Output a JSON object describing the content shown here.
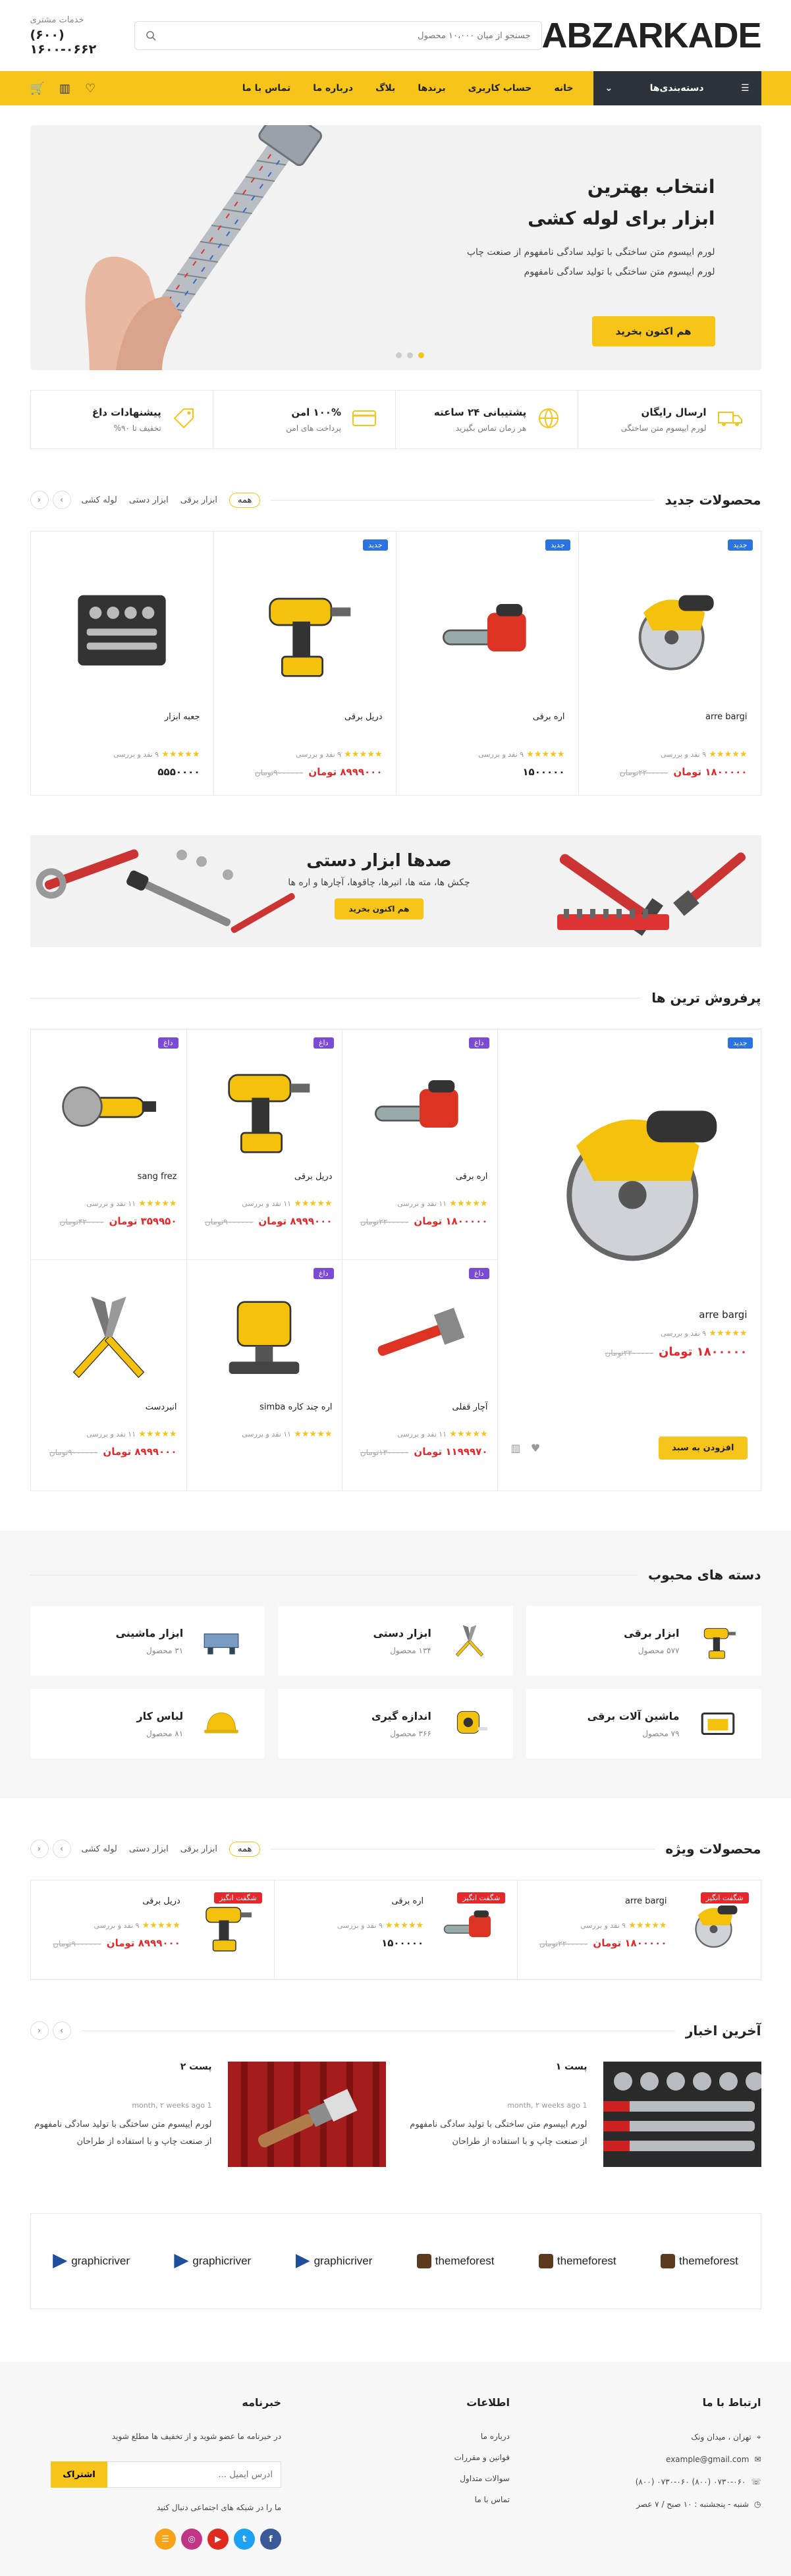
{
  "header": {
    "logo": "ABZARKADE",
    "search_placeholder": "جستجو از میان ۱۰،۰۰۰ محصول",
    "support_label": "خدمات مشتری",
    "support_phone": "(۶۰۰) ۱۶۰۰-۰۶۶۲"
  },
  "nav": {
    "categories_label": "دسته‌بندی‌ها",
    "items": [
      "خانه",
      "حساب کاربری",
      "برندها",
      "بلاگ",
      "درباره ما",
      "تماس با ما"
    ]
  },
  "hero": {
    "title_1": "انتخاب بهترین",
    "title_2": "ابزار برای لوله کشی",
    "line_1": "لورم ایپسوم متن ساختگی با تولید سادگی نامفهوم از صنعت چاپ",
    "line_2": "لورم ایپسوم متن ساختگی با تولید سادگی نامفهوم",
    "button": "هم اکنون بخرید"
  },
  "features": [
    {
      "title": "ارسال رایگان",
      "sub": "لورم ایپسوم متن ساختگی",
      "icon": "truck-icon"
    },
    {
      "title": "پشتیبانی ۲۴ ساعته",
      "sub": "هر زمان تماس بگیرید",
      "icon": "globe-icon"
    },
    {
      "title": "۱۰۰% امن",
      "sub": "پرداخت های امن",
      "icon": "card-icon"
    },
    {
      "title": "پیشنهادات داغ",
      "sub": "تخفیف تا ۹۰%",
      "icon": "tag-icon"
    }
  ],
  "new_products": {
    "title": "محصولات جدید",
    "tabs": [
      "همه",
      "ابزار برقی",
      "ابزار دستی",
      "لوله کشی"
    ],
    "items": [
      {
        "badge": "جدید",
        "name": "arre bargi",
        "rating": "۹ نقد و بررسی",
        "price": "۱۸۰۰۰۰۰ تومان",
        "old": "۲۲۰۰۰۰۰تومان",
        "img": "saw"
      },
      {
        "badge": "جدید",
        "name": "اره برقی",
        "rating": "۹ نقد و بررسی",
        "price": "۱۵۰۰۰۰۰",
        "old": "",
        "img": "chainsaw"
      },
      {
        "badge": "جدید",
        "name": "دریل برقی",
        "rating": "۹ نقد و بررسی",
        "price": "۸۹۹۹۰۰۰ تومان",
        "old": "۹۰۰۰۰۰۰تومان",
        "img": "drill"
      },
      {
        "badge": "",
        "name": "جعبه ابزار",
        "rating": "۹ نقد و بررسی",
        "price": "۵۵۵۰۰۰۰",
        "old": "",
        "img": "toolbox"
      }
    ]
  },
  "banner": {
    "title": "صدها ابزار دستی",
    "sub": "چکش ها، مته ها، انبرها، چاقوها، آچارها و اره ها",
    "button": "هم اکنون بخرید"
  },
  "best": {
    "title": "پرفروش ترین ها",
    "big": {
      "badge": "جدید",
      "name": "arre bargi",
      "rating": "۹ نقد و بررسی",
      "price": "۱۸۰۰۰۰۰ تومان",
      "old": "۲۲۰۰۰۰۰تومان",
      "button": "افزودن به سبد"
    },
    "items": [
      {
        "badge": "داغ",
        "name": "اره برقی",
        "rating": "۱۱ نقد و بررسی",
        "price": "۱۸۰۰۰۰۰ تومان",
        "old": "۲۲۰۰۰۰۰تومان",
        "img": "chainsaw"
      },
      {
        "badge": "داغ",
        "name": "دریل برقی",
        "rating": "۱۱ نقد و بررسی",
        "price": "۸۹۹۹۰۰۰ تومان",
        "old": "۹۰۰۰۰۰۰تومان",
        "img": "drill"
      },
      {
        "badge": "داغ",
        "name": "sang frez",
        "rating": "۱۱ نقد و بررسی",
        "price": "۳۵۹۹۵۰ تومان",
        "old": "۴۲۰۰۰۰تومان",
        "img": "grinder"
      },
      {
        "badge": "داغ",
        "name": "آچار قفلی",
        "rating": "۱۱ نقد و بررسی",
        "price": "۱۱۹۹۹۷۰ تومان",
        "old": "۱۳۰۰۰۰۰تومان",
        "img": "wrench"
      },
      {
        "badge": "داغ",
        "name": "اره چند کاره simba",
        "rating": "۱۱ نقد و بررسی",
        "price": "",
        "old": "",
        "img": "router"
      },
      {
        "badge": "",
        "name": "انبردست",
        "rating": "۱۱ نقد و بررسی",
        "price": "۸۹۹۹۰۰۰ تومان",
        "old": "۹۰۰۰۰۰۰تومان",
        "img": "pliers"
      }
    ]
  },
  "categories": {
    "title": "دسته های محبوب",
    "items": [
      {
        "name": "ابزار برقی",
        "count": "۵۷۷ محصول",
        "img": "drill"
      },
      {
        "name": "ابزار دستی",
        "count": "۱۳۴ محصول",
        "img": "pliers"
      },
      {
        "name": "ابزار ماشینی",
        "count": "۳۱ محصول",
        "img": "lathe"
      },
      {
        "name": "ماشین آلات برقی",
        "count": "۷۹ محصول",
        "img": "generator"
      },
      {
        "name": "اندازه گیری",
        "count": "۳۶۶ محصول",
        "img": "tape"
      },
      {
        "name": "لباس کار",
        "count": "۸۱ محصول",
        "img": "helmet"
      }
    ]
  },
  "special": {
    "title": "محصولات ویژه",
    "tabs": [
      "همه",
      "ابزار برقی",
      "ابزار دستی",
      "لوله کشی"
    ],
    "items": [
      {
        "badge": "شگفت انگیز",
        "name": "arre bargi",
        "rating": "۹ نقد و بررسی",
        "price": "۱۸۰۰۰۰۰ تومان",
        "old": "۲۲۰۰۰۰۰تومان",
        "img": "saw"
      },
      {
        "badge": "شگفت انگیز",
        "name": "اره برقی",
        "rating": "۹ نقد و بررسی",
        "price": "۱۵۰۰۰۰۰",
        "old": "",
        "img": "chainsaw"
      },
      {
        "badge": "شگفت انگیز",
        "name": "دریل برقی",
        "rating": "۹ نقد و بررسی",
        "price": "۸۹۹۹۰۰۰ تومان",
        "old": "۹۰۰۰۰۰۰تومان",
        "img": "drill"
      }
    ]
  },
  "news": {
    "title": "آخرین اخبار",
    "posts": [
      {
        "title": "پست ۱",
        "meta": "month, ۲ weeks ago 1",
        "excerpt": "لورم ایپسوم متن ساختگی با تولید سادگی نامفهوم از صنعت چاپ و با استفاده از طراحان"
      },
      {
        "title": "پست ۲",
        "meta": "month, ۲ weeks ago 1",
        "excerpt": "لورم ایپسوم متن ساختگی با تولید سادگی نامفهوم از صنعت چاپ و با استفاده از طراحان"
      }
    ]
  },
  "brands": [
    "themeforest",
    "themeforest",
    "themeforest",
    "graphicriver",
    "graphicriver",
    "graphicriver"
  ],
  "footer": {
    "contact_title": "ارتباط با ما",
    "address": "تهران ، میدان ونک",
    "email": "example@gmail.com",
    "phones": "۰۷۳۰-۰۶۰ (۸۰۰) ۰۷۳۰-۰۶۰ (۸۰۰)",
    "hours": "شنبه - پنجشنبه : ۱۰ صبح / ۷ عصر",
    "info_title": "اطلاعات",
    "links": [
      "درباره ما",
      "قوانین و مقررات",
      "سوالات متداول",
      "تماس با ما"
    ],
    "newsletter_title": "خبرنامه",
    "newsletter_text": "در خبرنامه ما عضو شوید و از تخفیف ها مطلع شوید",
    "email_placeholder": "آدرس ایمیل ...",
    "subscribe": "اشتراک",
    "social_text": "ما را در شبکه های اجتماعی دنبال کنید"
  },
  "colors": {
    "accent": "#f7c419",
    "dark": "#2d3338",
    "sale": "#e4282c",
    "new": "#2b73e0",
    "hot": "#7b4bd6"
  }
}
